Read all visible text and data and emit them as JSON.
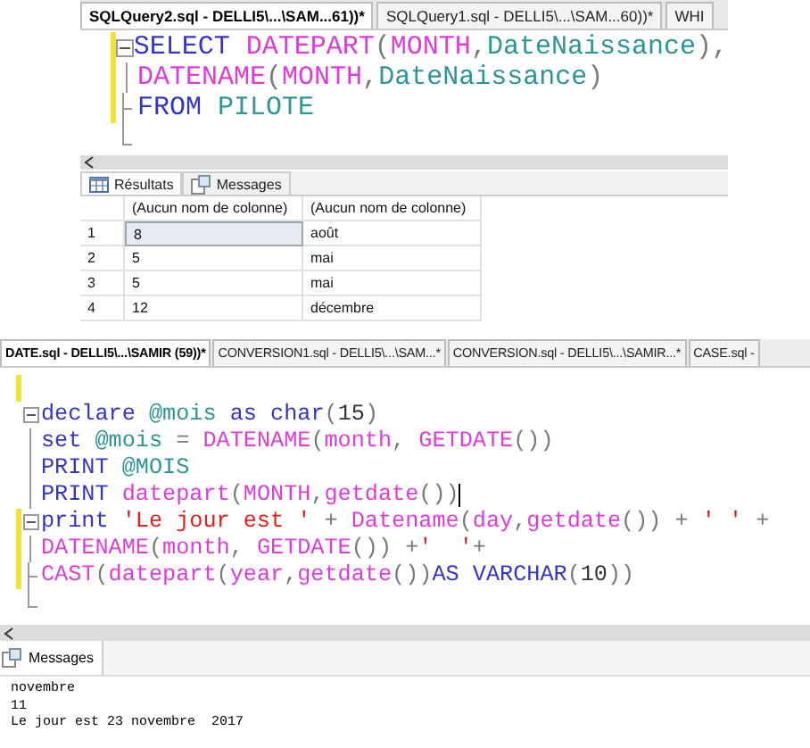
{
  "query_window": {
    "tabs": [
      {
        "label": "SQLQuery2.sql - DELLI5\\...\\SAM...61))*",
        "selected": true
      },
      {
        "label": "SQLQuery1.sql - DELLI5\\...\\SAM...60))*",
        "selected": false
      },
      {
        "label": "WHI",
        "selected": false
      }
    ],
    "code_lines": [
      {
        "kind": "open",
        "changed": true,
        "tokens": [
          {
            "t": "SELECT ",
            "kind": "kw"
          },
          {
            "t": "DATEPART",
            "kind": "fn"
          },
          {
            "t": "(",
            "kind": "op"
          },
          {
            "t": "MONTH",
            "kind": "fn"
          },
          {
            "t": ",",
            "kind": "op"
          },
          {
            "t": "DateNaissance",
            "kind": "id"
          },
          {
            "t": "),",
            "kind": "op"
          }
        ]
      },
      {
        "kind": "mid",
        "changed": true,
        "tokens": [
          {
            "t": "DATENAME",
            "kind": "fn"
          },
          {
            "t": "(",
            "kind": "op"
          },
          {
            "t": "MONTH",
            "kind": "fn"
          },
          {
            "t": ",",
            "kind": "op"
          },
          {
            "t": "DateNaissance",
            "kind": "id"
          },
          {
            "t": ")",
            "kind": "op"
          }
        ]
      },
      {
        "kind": "tick",
        "changed": true,
        "tokens": [
          {
            "t": "FROM ",
            "kind": "kw"
          },
          {
            "t": "PILOTE",
            "kind": "id"
          }
        ]
      },
      {
        "kind": "end",
        "changed": false
      }
    ],
    "result_tabs": [
      {
        "label": "Résultats",
        "selected": true
      },
      {
        "label": "Messages",
        "selected": false
      }
    ],
    "table": {
      "columns": [
        "(Aucun nom de colonne)",
        "(Aucun nom de colonne)"
      ],
      "rows": [
        {
          "number": "1",
          "cells": [
            "8",
            "août"
          ],
          "selected": true
        },
        {
          "number": "2",
          "cells": [
            "5",
            "mai"
          ],
          "selected": false
        },
        {
          "number": "3",
          "cells": [
            "5",
            "mai"
          ],
          "selected": false
        },
        {
          "number": "4",
          "cells": [
            "12",
            "décembre"
          ],
          "selected": false
        }
      ]
    }
  },
  "script_window": {
    "tabs": [
      {
        "label": "DATE.sql - DELLI5\\...\\SAMIR (59))*",
        "selected": true
      },
      {
        "label": "CONVERSION1.sql - DELLI5\\...\\SAM...*",
        "selected": false
      },
      {
        "label": "CONVERSION.sql - DELLI5\\...\\SAMIR...*",
        "selected": false
      },
      {
        "label": "CASE.sql -",
        "selected": false
      }
    ],
    "code_lines": [
      {
        "kind": "plain",
        "changed": true
      },
      {
        "kind": "open",
        "changed": false,
        "tokens": [
          {
            "t": "declare ",
            "kind": "kw"
          },
          {
            "t": "@mois ",
            "kind": "id"
          },
          {
            "t": "as ",
            "kind": "kw"
          },
          {
            "t": "char",
            "kind": "kw"
          },
          {
            "t": "(",
            "kind": "op"
          },
          {
            "t": "15",
            "kind": "num"
          },
          {
            "t": ")",
            "kind": "op"
          }
        ]
      },
      {
        "kind": "mid",
        "changed": false,
        "tokens": [
          {
            "t": "set ",
            "kind": "kw"
          },
          {
            "t": "@mois ",
            "kind": "id"
          },
          {
            "t": "= ",
            "kind": "op"
          },
          {
            "t": "DATENAME",
            "kind": "fn"
          },
          {
            "t": "(",
            "kind": "op"
          },
          {
            "t": "month",
            "kind": "fn"
          },
          {
            "t": ", ",
            "kind": "op"
          },
          {
            "t": "GETDATE",
            "kind": "fn"
          },
          {
            "t": "())",
            "kind": "op"
          }
        ]
      },
      {
        "kind": "mid",
        "changed": false,
        "tokens": [
          {
            "t": "PRINT ",
            "kind": "kw"
          },
          {
            "t": "@MOIS",
            "kind": "id"
          }
        ]
      },
      {
        "kind": "mid",
        "changed": false,
        "cursor": true,
        "tokens": [
          {
            "t": "PRINT ",
            "kind": "kw"
          },
          {
            "t": "datepart",
            "kind": "fn"
          },
          {
            "t": "(",
            "kind": "op"
          },
          {
            "t": "MONTH",
            "kind": "fn"
          },
          {
            "t": ",",
            "kind": "op"
          },
          {
            "t": "getdate",
            "kind": "fn"
          },
          {
            "t": "())",
            "kind": "op"
          }
        ]
      },
      {
        "kind": "open",
        "changed": true,
        "tokens": [
          {
            "t": "print ",
            "kind": "kw"
          },
          {
            "t": "'Le jour est '",
            "kind": "str"
          },
          {
            "t": " + ",
            "kind": "op"
          },
          {
            "t": "Datename",
            "kind": "fn"
          },
          {
            "t": "(",
            "kind": "op"
          },
          {
            "t": "day",
            "kind": "fn"
          },
          {
            "t": ",",
            "kind": "op"
          },
          {
            "t": "getdate",
            "kind": "fn"
          },
          {
            "t": "()) + ",
            "kind": "op"
          },
          {
            "t": "' '",
            "kind": "str"
          },
          {
            "t": " +",
            "kind": "op"
          }
        ]
      },
      {
        "kind": "mid",
        "changed": true,
        "tokens": [
          {
            "t": "DATENAME",
            "kind": "fn"
          },
          {
            "t": "(",
            "kind": "op"
          },
          {
            "t": "month",
            "kind": "fn"
          },
          {
            "t": ", ",
            "kind": "op"
          },
          {
            "t": "GETDATE",
            "kind": "fn"
          },
          {
            "t": "()) +",
            "kind": "op"
          },
          {
            "t": "'  '",
            "kind": "str"
          },
          {
            "t": "+",
            "kind": "op"
          }
        ]
      },
      {
        "kind": "tick",
        "changed": true,
        "tokens": [
          {
            "t": "CAST",
            "kind": "fn"
          },
          {
            "t": "(",
            "kind": "op"
          },
          {
            "t": "datepart",
            "kind": "fn"
          },
          {
            "t": "(",
            "kind": "op"
          },
          {
            "t": "year",
            "kind": "fn"
          },
          {
            "t": ",",
            "kind": "op"
          },
          {
            "t": "getdate",
            "kind": "fn"
          },
          {
            "t": "())",
            "kind": "op"
          },
          {
            "t": "AS ",
            "kind": "kw"
          },
          {
            "t": "VARCHAR",
            "kind": "kw"
          },
          {
            "t": "(",
            "kind": "op"
          },
          {
            "t": "10",
            "kind": "num"
          },
          {
            "t": "))",
            "kind": "op"
          }
        ]
      },
      {
        "kind": "end",
        "changed": false
      }
    ],
    "message_tab": {
      "label": "Messages",
      "selected": true
    },
    "messages": [
      "novembre",
      "11",
      "Le jour est 23 novembre  2017"
    ]
  }
}
